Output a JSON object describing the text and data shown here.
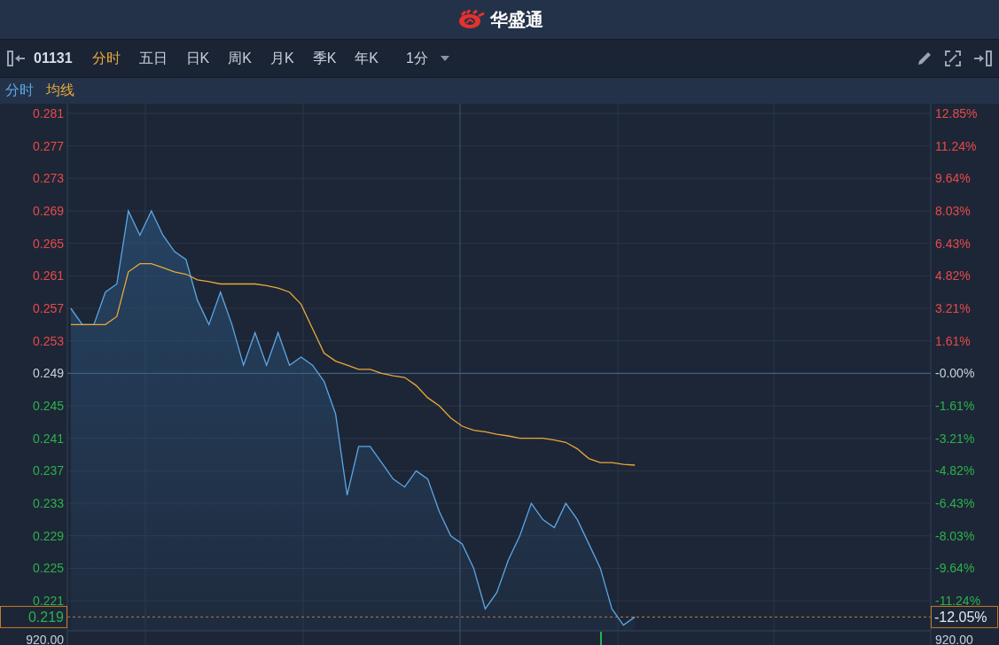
{
  "header": {
    "title": "华盛通"
  },
  "toolbar": {
    "code": "01131",
    "tabs": [
      {
        "label": "分时",
        "selected": true
      },
      {
        "label": "五日",
        "selected": false
      },
      {
        "label": "日K",
        "selected": false
      },
      {
        "label": "周K",
        "selected": false
      },
      {
        "label": "月K",
        "selected": false
      },
      {
        "label": "季K",
        "selected": false
      },
      {
        "label": "年K",
        "selected": false
      }
    ],
    "interval": "1分"
  },
  "change_axis": [
    {
      "label": "12.85%",
      "color": "#e84a4a"
    },
    {
      "label": "11.24%",
      "color": "#e84a4a"
    },
    {
      "label": "9.64%",
      "color": "#e84a4a"
    },
    {
      "label": "8.03%",
      "color": "#e84a4a"
    },
    {
      "label": "6.43%",
      "color": "#e84a4a"
    },
    {
      "label": "4.82%",
      "color": "#e84a4a"
    },
    {
      "label": "3.21%",
      "color": "#e84a4a"
    },
    {
      "label": "1.61%",
      "color": "#e84a4a"
    },
    {
      "label": "-0.00%",
      "color": "#c8d0dc"
    },
    {
      "label": "-1.61%",
      "color": "#2bb24c"
    },
    {
      "label": "-3.21%",
      "color": "#2bb24c"
    },
    {
      "label": "-4.82%",
      "color": "#2bb24c"
    },
    {
      "label": "-6.43%",
      "color": "#2bb24c"
    },
    {
      "label": "-8.03%",
      "color": "#2bb24c"
    },
    {
      "label": "-9.64%",
      "color": "#2bb24c"
    },
    {
      "label": "-11.24%",
      "color": "#2bb24c"
    }
  ],
  "current": {
    "price": "0.219",
    "change": "-12.05%"
  },
  "volume_labels": [
    "920.00",
    "920.00"
  ],
  "chart_data": {
    "type": "line",
    "ylim": [
      0.2173,
      0.2822
    ],
    "grid": true,
    "ref_lines": [
      {
        "axis": "y",
        "value": 0.249,
        "color": "#4a6a8c"
      },
      {
        "axis": "y",
        "value": 0.219,
        "color": "#d07a2a"
      }
    ],
    "yticks": [
      {
        "value": 0.281,
        "label": "0.281"
      },
      {
        "value": 0.277,
        "label": "0.277"
      },
      {
        "value": 0.273,
        "label": "0.273"
      },
      {
        "value": 0.269,
        "label": "0.269"
      },
      {
        "value": 0.265,
        "label": "0.265"
      },
      {
        "value": 0.261,
        "label": "0.261"
      },
      {
        "value": 0.257,
        "label": "0.257"
      },
      {
        "value": 0.253,
        "label": "0.253"
      },
      {
        "value": 0.249,
        "label": "0.249"
      },
      {
        "value": 0.245,
        "label": "0.245"
      },
      {
        "value": 0.241,
        "label": "0.241"
      },
      {
        "value": 0.237,
        "label": "0.237"
      },
      {
        "value": 0.233,
        "label": "0.233"
      },
      {
        "value": 0.229,
        "label": "0.229"
      },
      {
        "value": 0.225,
        "label": "0.225"
      },
      {
        "value": 0.221,
        "label": "0.221"
      }
    ],
    "categories": [
      null,
      null,
      null,
      null,
      null,
      null,
      null,
      null,
      null,
      null,
      null,
      null,
      null,
      null,
      null,
      null,
      null,
      null,
      null,
      null,
      null,
      null,
      null,
      null,
      null,
      null,
      null,
      null,
      null,
      null,
      null,
      null,
      null,
      null,
      null,
      null,
      null,
      null,
      null,
      null,
      null,
      null,
      null,
      null,
      null,
      null,
      null,
      null,
      null,
      null,
      null,
      null,
      null,
      null,
      null,
      null,
      null,
      null,
      null,
      null,
      null,
      null,
      null,
      null,
      null,
      null,
      null,
      null,
      null,
      null,
      null,
      null,
      null,
      null,
      null
    ],
    "series": [
      {
        "name": "分时",
        "color": "#5ba7e6",
        "values": [
          0.257,
          0.255,
          0.255,
          0.259,
          0.26,
          0.269,
          0.266,
          0.269,
          0.266,
          0.264,
          0.263,
          0.258,
          0.255,
          0.259,
          0.255,
          0.25,
          0.254,
          0.25,
          0.254,
          0.25,
          0.251,
          0.25,
          0.248,
          0.244,
          0.234,
          0.24,
          0.24,
          0.238,
          0.236,
          0.235,
          0.237,
          0.236,
          0.232,
          0.229,
          0.228,
          0.225,
          0.22,
          0.222,
          0.226,
          0.229,
          0.233,
          0.231,
          0.23,
          0.233,
          0.231,
          0.228,
          0.225,
          0.22,
          0.218,
          0.219,
          null,
          null,
          null,
          null,
          null,
          null,
          null,
          null,
          null,
          null,
          null,
          null,
          null,
          null,
          null,
          null,
          null,
          null,
          null,
          null,
          null,
          null,
          null,
          null,
          null
        ]
      },
      {
        "name": "均线",
        "color": "#e8a93a",
        "values": [
          0.255,
          0.255,
          0.255,
          0.255,
          0.256,
          0.2615,
          0.2625,
          0.2625,
          0.262,
          0.2615,
          0.2612,
          0.2605,
          0.2603,
          0.26,
          0.26,
          0.26,
          0.26,
          0.2598,
          0.2595,
          0.259,
          0.2575,
          0.2545,
          0.2515,
          0.2505,
          0.25,
          0.2495,
          0.2495,
          0.249,
          0.2487,
          0.2485,
          0.2475,
          0.246,
          0.245,
          0.2435,
          0.2425,
          0.242,
          0.2418,
          0.2415,
          0.2413,
          0.241,
          0.241,
          0.241,
          0.2408,
          0.2405,
          0.2397,
          0.2385,
          0.238,
          0.238,
          0.2378,
          0.2377,
          null,
          null,
          null,
          null,
          null,
          null,
          null,
          null,
          null,
          null,
          null,
          null,
          null,
          null,
          null,
          null,
          null,
          null,
          null,
          null,
          null,
          null,
          null,
          null,
          null
        ]
      }
    ]
  }
}
